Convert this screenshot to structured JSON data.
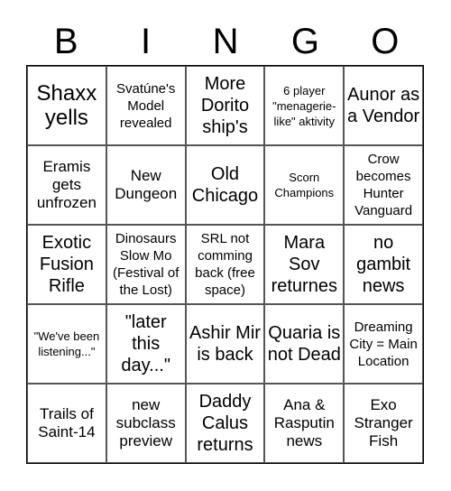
{
  "header": [
    "B",
    "I",
    "N",
    "G",
    "O"
  ],
  "cells": [
    {
      "text": "Shaxx yells",
      "size": "xl"
    },
    {
      "text": "Svatúne's Model revealed",
      "size": "sm"
    },
    {
      "text": "More Dorito ship's",
      "size": "lg"
    },
    {
      "text": "6 player \"menagerie-like\" aktivity",
      "size": "xs"
    },
    {
      "text": "Aunor as a Vendor",
      "size": "lg"
    },
    {
      "text": "Eramis gets unfrozen",
      "size": "md"
    },
    {
      "text": "New Dungeon",
      "size": "md"
    },
    {
      "text": "Old Chicago",
      "size": "lg"
    },
    {
      "text": "Scorn Champions",
      "size": "xs"
    },
    {
      "text": "Crow becomes Hunter Vanguard",
      "size": "sm"
    },
    {
      "text": "Exotic Fusion Rifle",
      "size": "lg"
    },
    {
      "text": "Dinosaurs Slow Mo (Festival of the Lost)",
      "size": "sm"
    },
    {
      "text": "SRL not comming back (free space)",
      "size": "sm"
    },
    {
      "text": "Mara Sov returnes",
      "size": "lg"
    },
    {
      "text": "no gambit news",
      "size": "lg"
    },
    {
      "text": "\"We've been listening...\"",
      "size": "xs"
    },
    {
      "text": "\"later this day...\"",
      "size": "lg"
    },
    {
      "text": "Ashir Mir is back",
      "size": "lg"
    },
    {
      "text": "Quaria is not Dead",
      "size": "lg"
    },
    {
      "text": "Dreaming City = Main Location",
      "size": "sm"
    },
    {
      "text": "Trails of Saint-14",
      "size": "md"
    },
    {
      "text": "new subclass preview",
      "size": "md"
    },
    {
      "text": "Daddy Calus returns",
      "size": "lg"
    },
    {
      "text": "Ana & Rasputin news",
      "size": "md"
    },
    {
      "text": "Exo Stranger Fish",
      "size": "md"
    }
  ]
}
